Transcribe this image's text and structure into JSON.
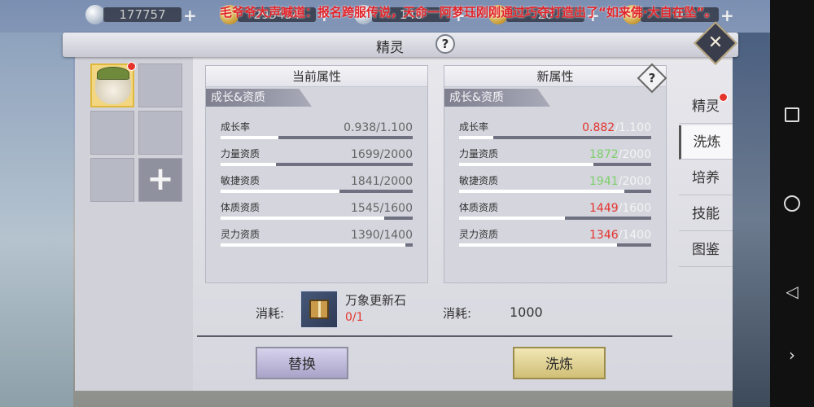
{
  "topbar": {
    "currencies": [
      {
        "icon": "silver-coin-icon",
        "value": "177757"
      },
      {
        "icon": "gold-coin-icon",
        "value": "293494"
      },
      {
        "icon": "ingot-icon",
        "value": "148"
      },
      {
        "icon": "gem-icon",
        "value": "20"
      },
      {
        "icon": "gold-ingot-icon",
        "value": "0"
      }
    ],
    "broadcast": "毛爷爷大声喊道：报名跨服传说，天命一阿梦珏刚刚通过巧夺打造出了“如来佛·大自在坠”。"
  },
  "panel": {
    "title": "精灵",
    "help": "?",
    "close": "✕"
  },
  "current": {
    "title": "当前属性",
    "section": "成长&资质",
    "stats": [
      {
        "label": "成长率",
        "value": "0.938",
        "max": "/1.100",
        "fill": 0.3
      },
      {
        "label": "力量资质",
        "value": "1699",
        "max": "/2000",
        "fill": 0.29
      },
      {
        "label": "敏捷资质",
        "value": "1841",
        "max": "/2000",
        "fill": 0.62
      },
      {
        "label": "体质资质",
        "value": "1545",
        "max": "/1600",
        "fill": 0.85
      },
      {
        "label": "灵力资质",
        "value": "1390",
        "max": "/1400",
        "fill": 0.96
      }
    ]
  },
  "new": {
    "title": "新属性",
    "section": "成长&资质",
    "help": "?",
    "stats": [
      {
        "label": "成长率",
        "value": "0.882",
        "max": "/1.100",
        "fill": 0.18,
        "tone": "hi"
      },
      {
        "label": "力量资质",
        "value": "1872",
        "max": "/2000",
        "fill": 0.7,
        "tone": "up"
      },
      {
        "label": "敏捷资质",
        "value": "1941",
        "max": "/2000",
        "fill": 0.86,
        "tone": "up"
      },
      {
        "label": "体质资质",
        "value": "1449",
        "max": "/1600",
        "fill": 0.55,
        "tone": "hi"
      },
      {
        "label": "灵力资质",
        "value": "1346",
        "max": "/1400",
        "fill": 0.82,
        "tone": "hi"
      }
    ]
  },
  "tabs": [
    "精灵",
    "洗炼",
    "培养",
    "技能",
    "图鉴"
  ],
  "cost": {
    "label1": "消耗:",
    "item_name": "万象更新石",
    "item_count": "0/1",
    "label2": "消耗:",
    "amount": "1000"
  },
  "buttons": {
    "replace": "替换",
    "refine": "洗炼"
  },
  "colors": {
    "warning": "#e5342c",
    "increase": "#7cd06a"
  }
}
